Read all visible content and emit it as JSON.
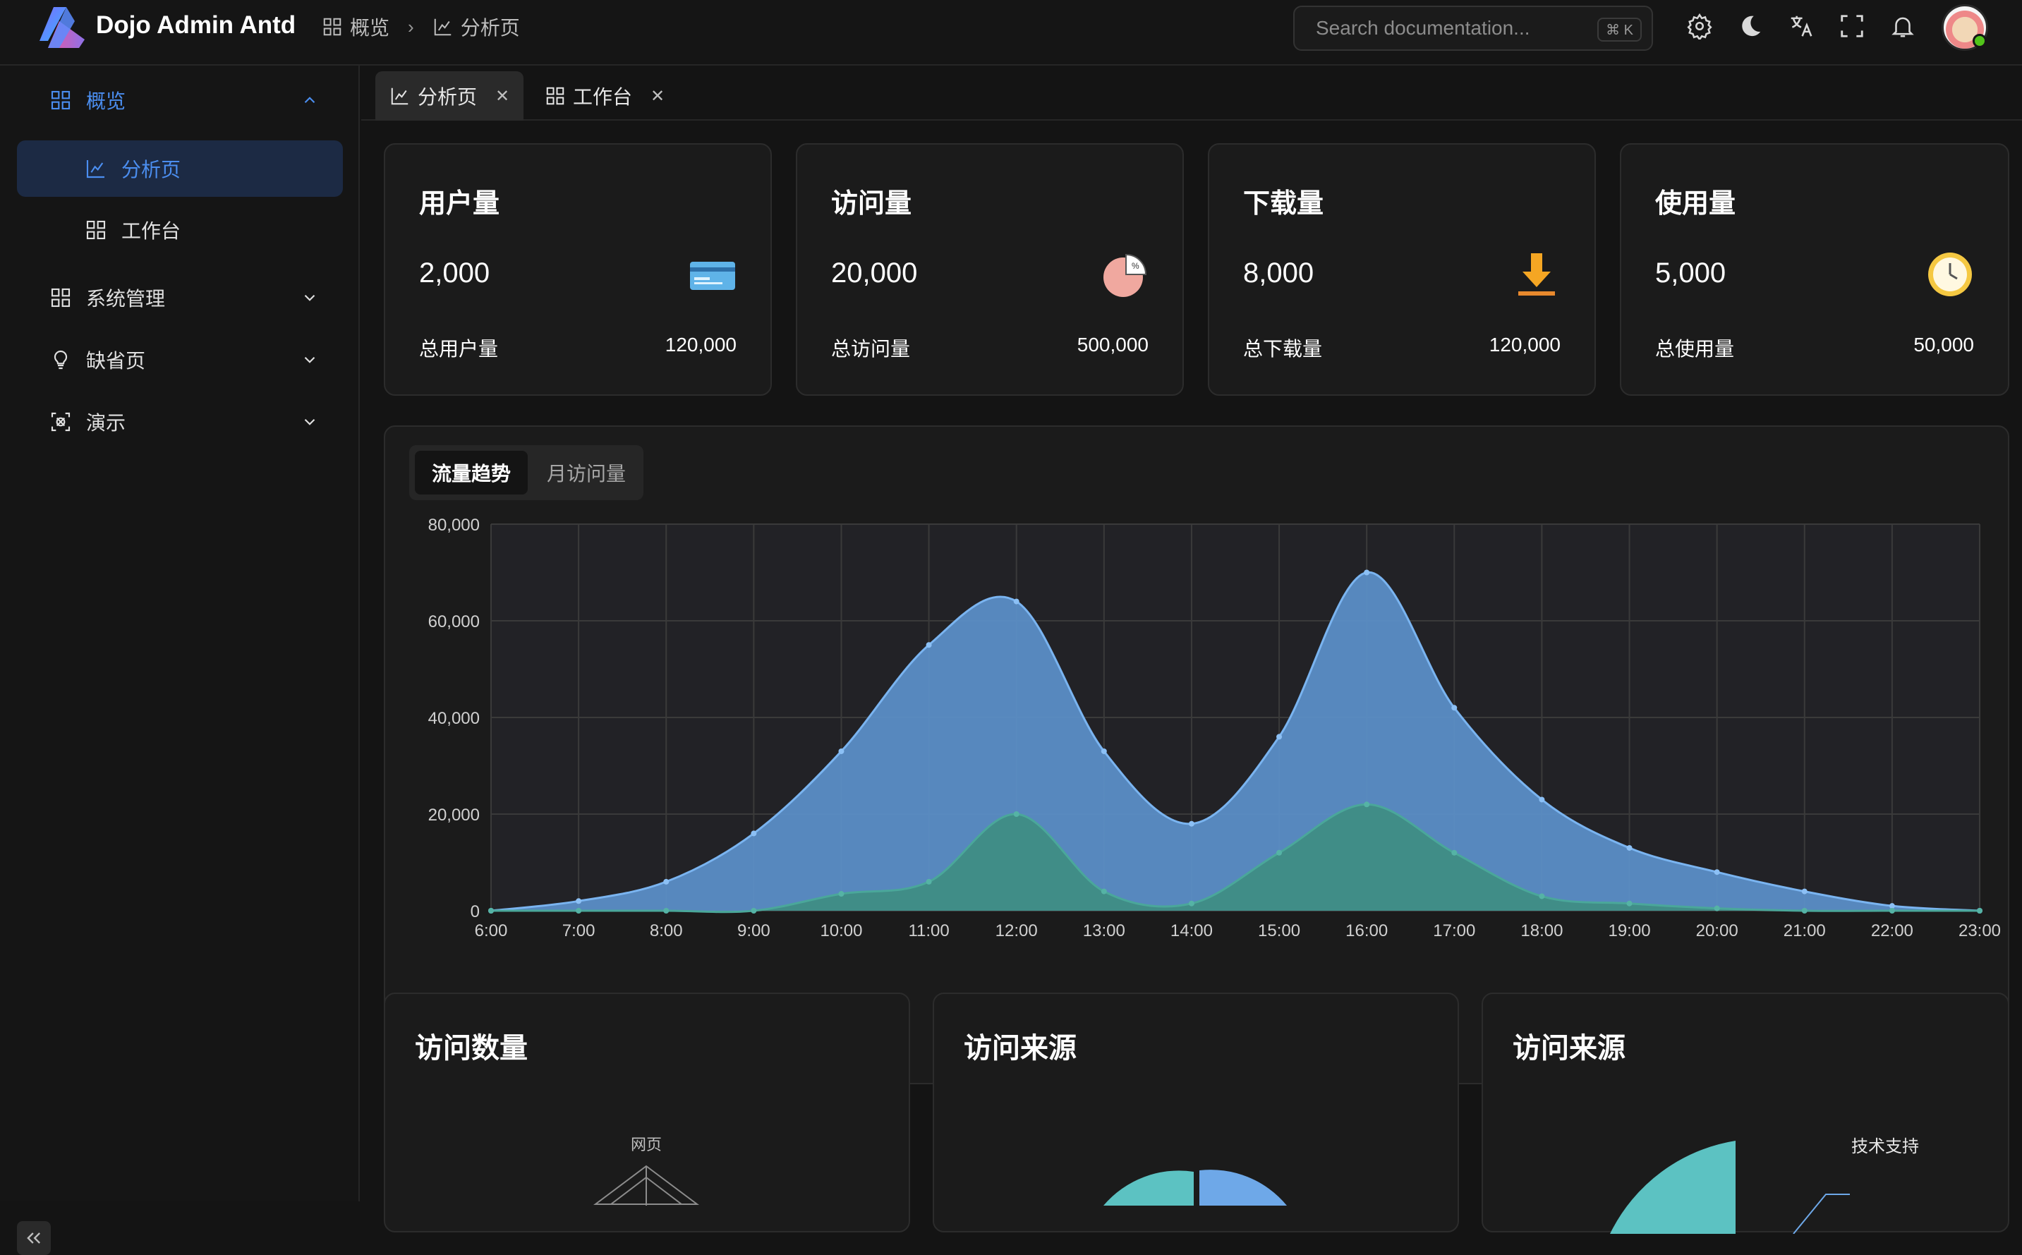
{
  "app": {
    "title": "Dojo Admin Antd"
  },
  "breadcrumb": [
    {
      "label": "概览",
      "icon": "dashboard-icon"
    },
    {
      "label": "分析页",
      "icon": "chart-icon"
    }
  ],
  "search": {
    "placeholder": "Search documentation...",
    "shortcut": "⌘ K"
  },
  "header_icons": [
    "settings-icon",
    "moon-icon",
    "translate-icon",
    "fullscreen-icon",
    "bell-icon"
  ],
  "sidebar": {
    "items": [
      {
        "label": "概览",
        "icon": "dashboard-icon",
        "expanded": true
      },
      {
        "label": "分析页",
        "icon": "chart-icon",
        "active": true
      },
      {
        "label": "工作台",
        "icon": "workbench-icon"
      },
      {
        "label": "系统管理",
        "icon": "system-icon"
      },
      {
        "label": "缺省页",
        "icon": "bulb-icon"
      },
      {
        "label": "演示",
        "icon": "demo-icon"
      }
    ]
  },
  "tabs": [
    {
      "label": "分析页",
      "icon": "chart-icon",
      "active": true
    },
    {
      "label": "工作台",
      "icon": "workbench-icon"
    }
  ],
  "stats": [
    {
      "title": "用户量",
      "value": "2,000",
      "foot_label": "总用户量",
      "foot_value": "120,000",
      "icon": "card-icon"
    },
    {
      "title": "访问量",
      "value": "20,000",
      "foot_label": "总访问量",
      "foot_value": "500,000",
      "icon": "pie-icon"
    },
    {
      "title": "下载量",
      "value": "8,000",
      "foot_label": "总下载量",
      "foot_value": "120,000",
      "icon": "download-icon"
    },
    {
      "title": "使用量",
      "value": "5,000",
      "foot_label": "总使用量",
      "foot_value": "50,000",
      "icon": "clock-icon"
    }
  ],
  "trend": {
    "tabs": [
      "流量趋势",
      "月访问量"
    ]
  },
  "chart_data": {
    "type": "area",
    "x": [
      "6:00",
      "7:00",
      "8:00",
      "9:00",
      "10:00",
      "11:00",
      "12:00",
      "13:00",
      "14:00",
      "15:00",
      "16:00",
      "17:00",
      "18:00",
      "19:00",
      "20:00",
      "21:00",
      "22:00",
      "23:00"
    ],
    "yticks": [
      "0",
      "20,000",
      "40,000",
      "60,000",
      "80,000"
    ],
    "ylim": [
      0,
      80000
    ],
    "grid": true,
    "series": [
      {
        "values": [
          0,
          2000,
          6000,
          16000,
          33000,
          55000,
          64000,
          33000,
          18000,
          36000,
          70000,
          42000,
          23000,
          13000,
          8000,
          4000,
          1000,
          0
        ],
        "color": "#5b8ec6"
      },
      {
        "values": [
          0,
          0,
          0,
          0,
          3500,
          6000,
          20000,
          4000,
          1500,
          12000,
          22000,
          12000,
          3000,
          1500,
          500,
          0,
          0,
          0
        ],
        "color": "#3f8d84"
      }
    ]
  },
  "panels": [
    {
      "title": "访问数量",
      "radar_label": "网页"
    },
    {
      "title": "访问来源"
    },
    {
      "title": "访问来源",
      "pie_label": "技术支持"
    }
  ]
}
